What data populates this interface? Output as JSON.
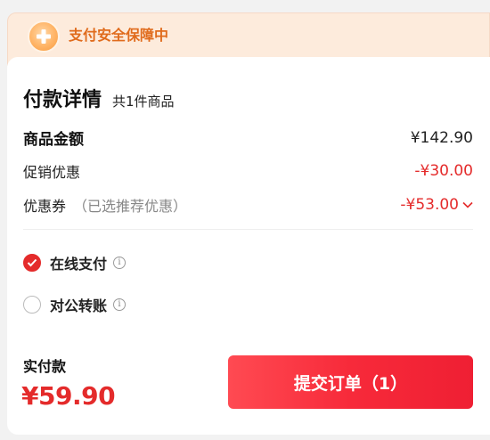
{
  "banner": {
    "text": "支付安全保障中",
    "icon": "shield-plus-icon"
  },
  "details": {
    "title": "付款详情",
    "subtitle": "共1件商品",
    "rows": [
      {
        "label": "商品金额",
        "value": "¥142.90"
      },
      {
        "label": "促销优惠",
        "value": "-¥30.00"
      },
      {
        "label": "优惠券",
        "hint": "（已选推荐优惠）",
        "value": "-¥53.00"
      }
    ]
  },
  "payment": {
    "options": [
      {
        "label": "在线支付",
        "selected": true
      },
      {
        "label": "对公转账",
        "selected": false
      }
    ]
  },
  "footer": {
    "total_label": "实付款",
    "total_amount": "¥59.90",
    "submit_label": "提交订单（1）"
  },
  "colors": {
    "accent_red": "#e42b2b",
    "banner_bg": "#fdebdc",
    "banner_text": "#e06b1c"
  }
}
